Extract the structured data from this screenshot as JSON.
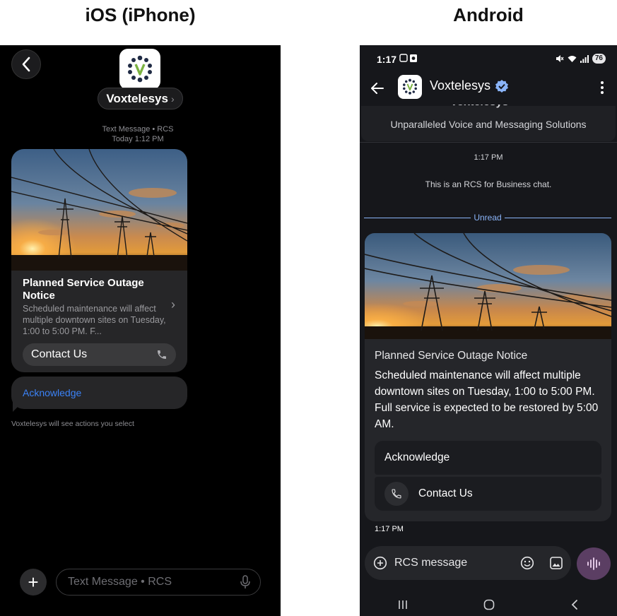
{
  "headings": {
    "ios": "iOS (iPhone)",
    "android": "Android"
  },
  "ios": {
    "sender_name": "Voxtelesys",
    "meta_line1": "Text Message • RCS",
    "meta_line2": "Today 1:12 PM",
    "card": {
      "title": "Planned Service Outage Notice",
      "description": "Scheduled maintenance will affect multiple downtown sites on Tuesday, 1:00 to 5:00 PM. F...",
      "contact_label": "Contact Us"
    },
    "acknowledge_label": "Acknowledge",
    "actions_note": "Voxtelesys will see actions you select",
    "input_placeholder": "Text Message • RCS"
  },
  "android": {
    "status_time": "1:17",
    "battery": "76",
    "sender_name": "Voxtelesys",
    "header_partial_name": "Voxtelesys",
    "tagline": "Unparalleled Voice and Messaging Solutions",
    "time_center": "1:17 PM",
    "info": "This is an RCS for Business chat.",
    "unread_label": "Unread",
    "card": {
      "title": "Planned Service Outage Notice",
      "description": "Scheduled maintenance will affect multiple downtown sites on Tuesday, 1:00 to 5:00 PM. Full service is expected to be restored by 5:00 AM.",
      "acknowledge_label": "Acknowledge",
      "contact_label": "Contact Us"
    },
    "message_time": "1:17 PM",
    "input_placeholder": "RCS message"
  },
  "colors": {
    "accent_blue": "#3b82f6",
    "android_accent": "#8ab4f8",
    "verified": "#8ab4f8",
    "logo_green": "#7cb342",
    "logo_navy": "#1f2a44",
    "mic_button": "#5b3e63"
  }
}
